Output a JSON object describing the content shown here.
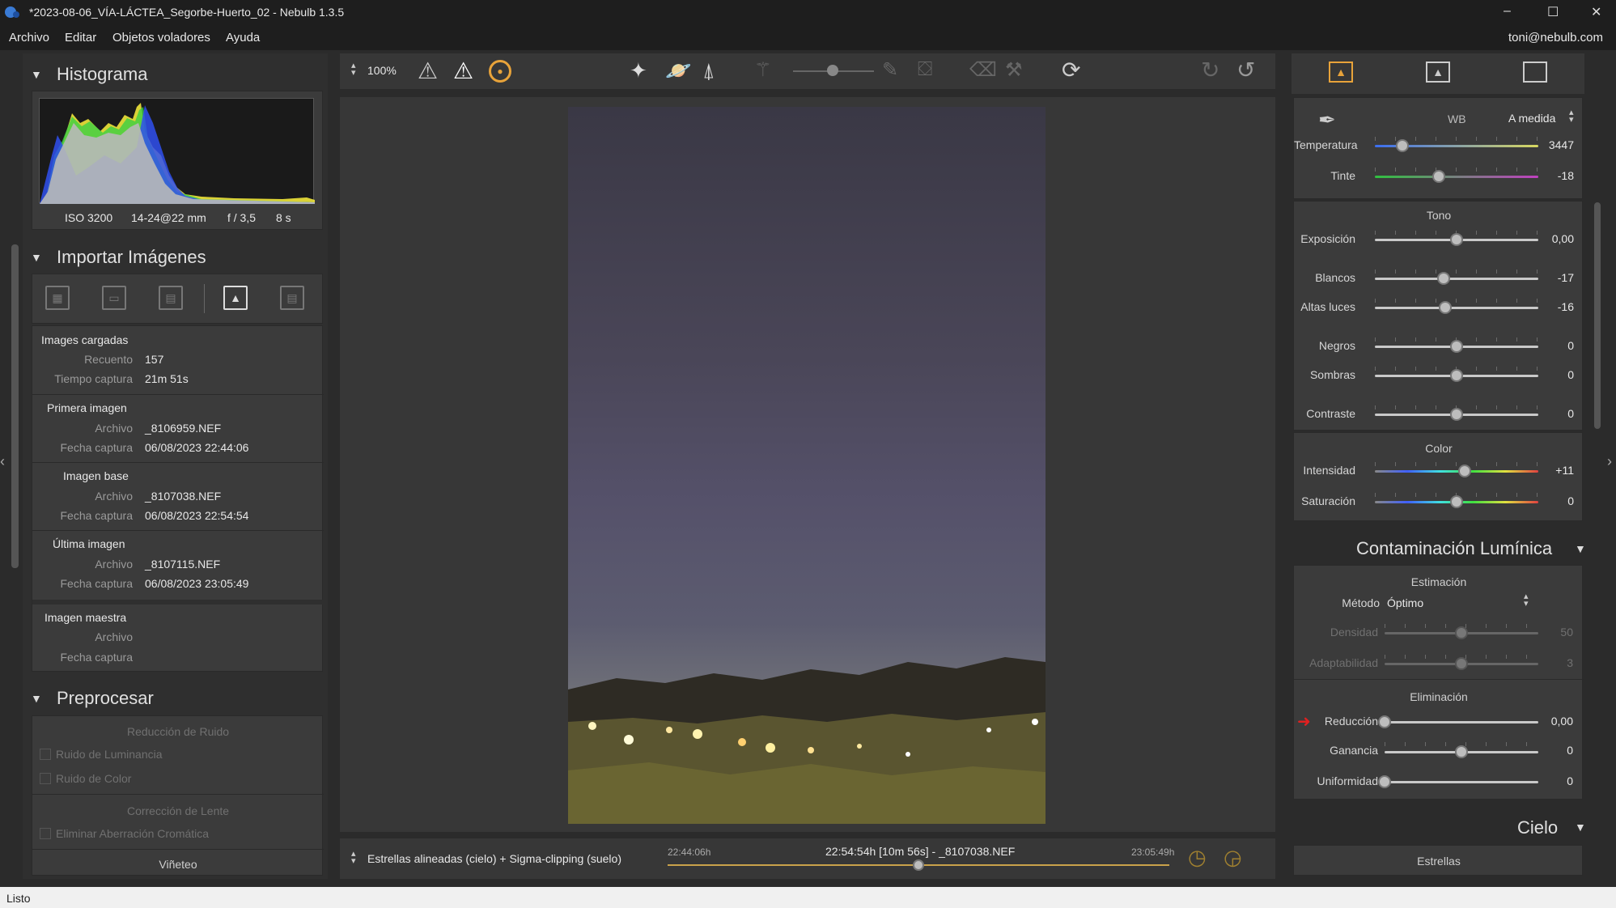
{
  "window": {
    "title": "*2023-08-06_VÍA-LÁCTEA_Segorbe-Huerto_02 - Nebulb 1.3.5",
    "minimize": "–",
    "maximize": "☐",
    "close": "✕"
  },
  "menu": {
    "items": [
      "Archivo",
      "Editar",
      "Objetos voladores",
      "Ayuda"
    ],
    "user": "toni@nebulb.com"
  },
  "left": {
    "histogram": {
      "title": "Histograma",
      "iso": "ISO 3200",
      "lens": "14-24@22 mm",
      "aperture": "f / 3,5",
      "exposure": "8 s"
    },
    "import": {
      "title": "Importar Imágenes",
      "loaded": {
        "title": "Images cargadas",
        "count_label": "Recuento",
        "count": "157",
        "time_label": "Tiempo captura",
        "time": "21m 51s"
      },
      "first": {
        "title": "Primera imagen",
        "file_label": "Archivo",
        "file": "_8106959.NEF",
        "date_label": "Fecha captura",
        "date": "06/08/2023 22:44:06"
      },
      "base": {
        "title": "Imagen base",
        "file_label": "Archivo",
        "file": "_8107038.NEF",
        "date_label": "Fecha captura",
        "date": "06/08/2023 22:54:54"
      },
      "last": {
        "title": "Última imagen",
        "file_label": "Archivo",
        "file": "_8107115.NEF",
        "date_label": "Fecha captura",
        "date": "06/08/2023 23:05:49"
      },
      "master": {
        "title": "Imagen maestra",
        "file_label": "Archivo",
        "date_label": "Fecha captura"
      }
    },
    "preprocess": {
      "title": "Preprocesar",
      "noise_title": "Reducción de Ruido",
      "lum_noise": "Ruido de Luminancia",
      "color_noise": "Ruido de Color",
      "lens_title": "Corrección de Lente",
      "chromatic": "Eliminar Aberración Cromática",
      "vignette": "Viñeteo"
    }
  },
  "toolbar": {
    "zoom": "100%"
  },
  "bottom": {
    "mode": "Estrellas alineadas (cielo) + Sigma-clipping (suelo)",
    "start": "22:44:06h",
    "current": "22:54:54h [10m 56s] - _8107038.NEF",
    "end": "23:05:49h",
    "timeline_position": 0.5
  },
  "right": {
    "wb": {
      "label": "WB",
      "value": "A medida"
    },
    "sliders_wb": [
      {
        "label": "Temperatura",
        "value": "3447",
        "pos": 0.17
      },
      {
        "label": "Tinte",
        "value": "-18",
        "pos": 0.39
      }
    ],
    "tone": {
      "title": "Tono"
    },
    "sliders_tone": [
      {
        "label": "Exposición",
        "value": "0,00",
        "pos": 0.5
      },
      {
        "label": "Blancos",
        "value": "-17",
        "pos": 0.42
      },
      {
        "label": "Altas luces",
        "value": "-16",
        "pos": 0.43
      },
      {
        "label": "Negros",
        "value": "0",
        "pos": 0.5
      },
      {
        "label": "Sombras",
        "value": "0",
        "pos": 0.5
      },
      {
        "label": "Contraste",
        "value": "0",
        "pos": 0.5
      }
    ],
    "color": {
      "title": "Color"
    },
    "sliders_color": [
      {
        "label": "Intensidad",
        "value": "+11",
        "pos": 0.55
      },
      {
        "label": "Saturación",
        "value": "0",
        "pos": 0.5
      }
    ],
    "lightpollution": {
      "title": "Contaminación Lumínica",
      "estimation": "Estimación",
      "method_label": "Método",
      "method": "Óptimo",
      "density_label": "Densidad",
      "density": "50",
      "density_pos": 0.5,
      "adapt_label": "Adaptabilidad",
      "adapt": "3",
      "adapt_pos": 0.5,
      "elimination": "Eliminación",
      "reduction_label": "Reducción",
      "reduction": "0,00",
      "reduction_pos": 0.0,
      "gain_label": "Ganancia",
      "gain": "0",
      "gain_pos": 0.5,
      "uniform_label": "Uniformidad",
      "uniform": "0",
      "uniform_pos": 0.0
    },
    "sky": {
      "title": "Cielo",
      "stars": "Estrellas"
    }
  },
  "status": {
    "text": "Listo"
  },
  "colors": {
    "accent": "#e8a33a",
    "background": "#2b2b2b",
    "panel": "#373737"
  }
}
